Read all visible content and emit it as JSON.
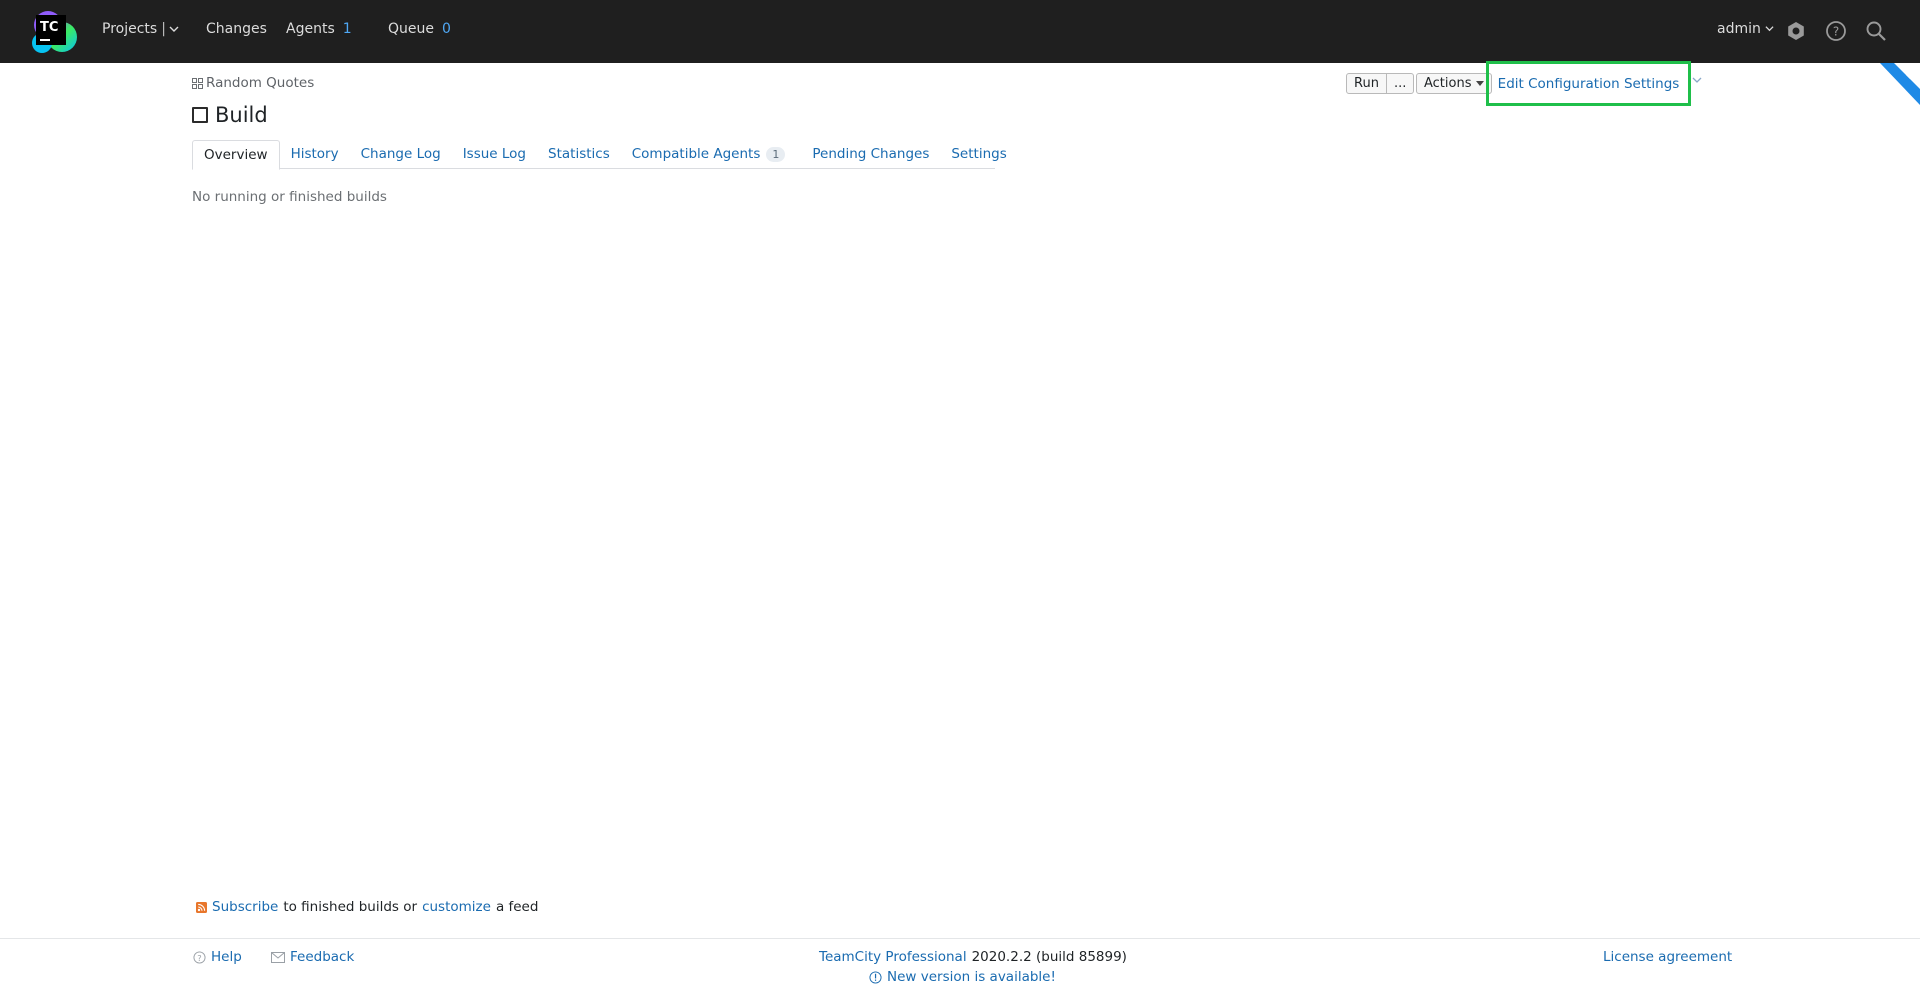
{
  "header": {
    "nav": {
      "projects": "Projects",
      "changes": "Changes",
      "agents": "Agents",
      "agents_count": "1",
      "queue": "Queue",
      "queue_count": "0"
    },
    "user": "admin"
  },
  "breadcrumb": {
    "project": "Random Quotes"
  },
  "page": {
    "title": "Build"
  },
  "toolbar": {
    "run_label": "Run",
    "run_more_label": "...",
    "actions_label": "Actions",
    "edit_config_label": "Edit Configuration Settings"
  },
  "tabs": [
    {
      "label": "Overview"
    },
    {
      "label": "History"
    },
    {
      "label": "Change Log"
    },
    {
      "label": "Issue Log"
    },
    {
      "label": "Statistics"
    },
    {
      "label": "Compatible Agents",
      "badge": "1"
    },
    {
      "label": "Pending Changes"
    },
    {
      "label": "Settings"
    }
  ],
  "content": {
    "empty_message": "No running or finished builds"
  },
  "subscribe": {
    "link1": "Subscribe",
    "text1": "to finished builds or",
    "link2": "customize",
    "text2": "a feed"
  },
  "footer": {
    "help": "Help",
    "feedback": "Feedback",
    "product": "TeamCity Professional",
    "version": "2020.2.2 (build 85899)",
    "new_version": "New version is available!",
    "license": "License agreement"
  },
  "colors": {
    "header_bg": "#1f1f1f",
    "link": "#1a6bb0",
    "highlight": "#1fbf4a",
    "count": "#4fa8f5"
  }
}
